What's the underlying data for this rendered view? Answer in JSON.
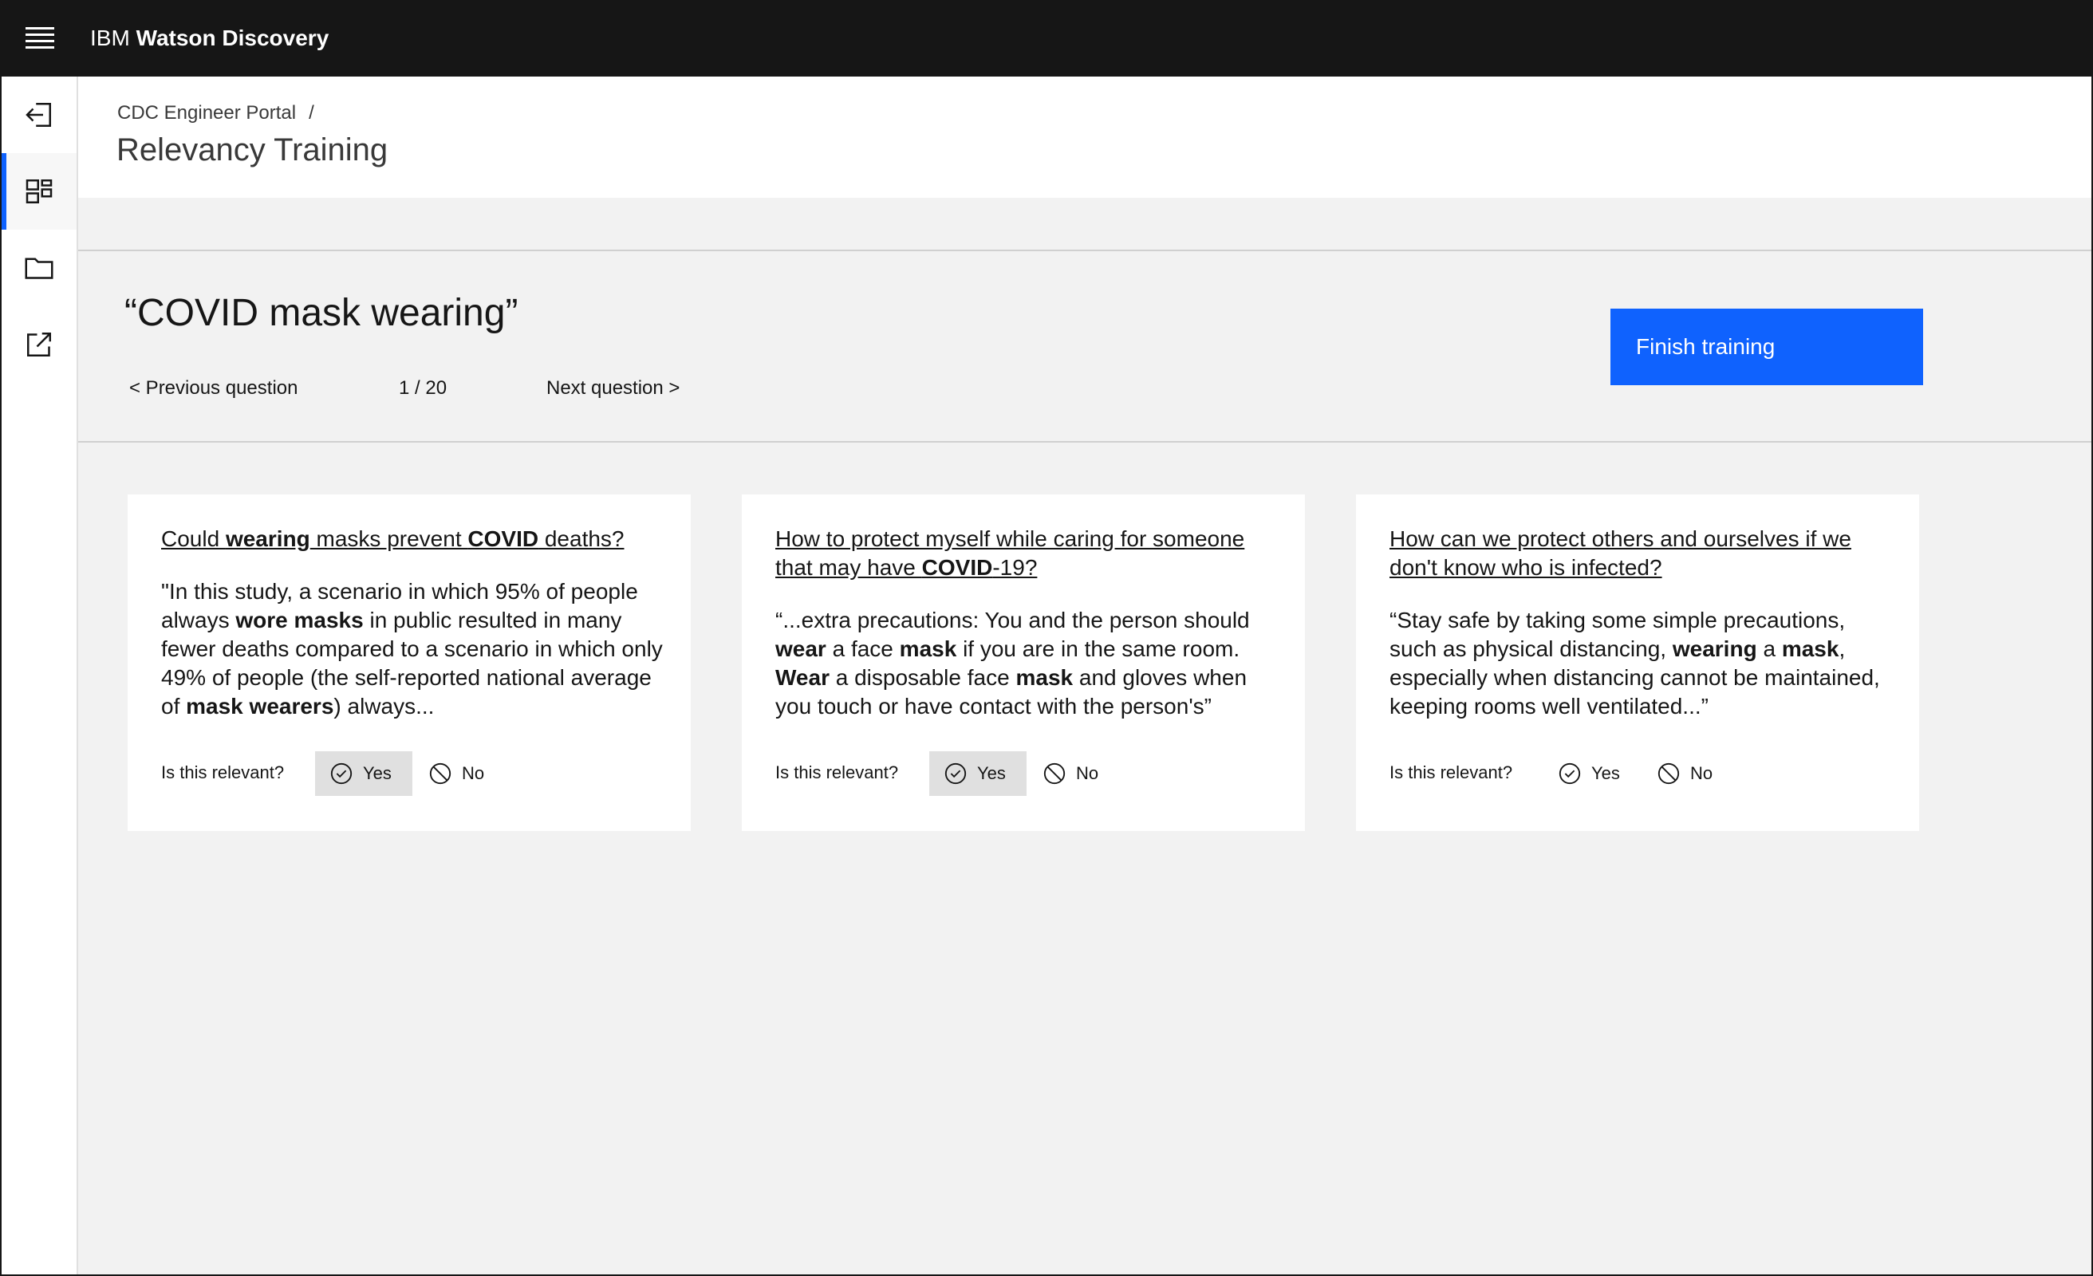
{
  "header": {
    "brand_prefix": "IBM",
    "brand_name": "Watson Discovery"
  },
  "siderail": {
    "items": [
      {
        "icon": "exit-icon"
      },
      {
        "icon": "dashboard-icon",
        "active": true
      },
      {
        "icon": "folder-icon"
      },
      {
        "icon": "launch-icon"
      }
    ]
  },
  "breadcrumb": {
    "parent": "CDC Engineer Portal",
    "separator": "/"
  },
  "page_title": "Relevancy Training",
  "question": {
    "query": "“COVID mask wearing”",
    "prev_label": "< Previous question",
    "counter": "1 / 20",
    "next_label": "Next question >"
  },
  "finish_button": "Finish training",
  "colors": {
    "accent": "#0f62fe",
    "header_bg": "#161616",
    "selected_bg": "#e0e0e0"
  },
  "cards": [
    {
      "title_html": "Could <b>wearing</b> masks prevent <b>COVID</b> deaths?",
      "excerpt_html": "\"In this study, a scenario in which 95% of people always <b>wore masks</b> in public resulted in many fewer deaths compared to a scenario in which only 49% of people (the self-reported national average of <b>mask wearers</b>) always...",
      "relevance_label": "Is this relevant?",
      "yes_label": "Yes",
      "no_label": "No",
      "selected": "yes"
    },
    {
      "title_html": "How to protect myself while caring for someone that may have <b>COVID</b>-19?",
      "excerpt_html": "“...extra precautions: You and the person should <b>wear</b> a face <b>mask</b> if you are in the same room. <b>Wear</b> a disposable face <b>mask</b> and gloves when you touch or have contact with the person's”",
      "relevance_label": "Is this relevant?",
      "yes_label": "Yes",
      "no_label": "No",
      "selected": "yes"
    },
    {
      "title_html": "How can we protect others and ourselves if we don't know who is infected?",
      "excerpt_html": "“Stay safe by taking some simple precautions, such as physical distancing, <b>wearing</b> a <b>mask</b>, especially when distancing cannot be maintained, keeping rooms well ventilated...”",
      "relevance_label": "Is this relevant?",
      "yes_label": "Yes",
      "no_label": "No",
      "selected": "none"
    }
  ]
}
